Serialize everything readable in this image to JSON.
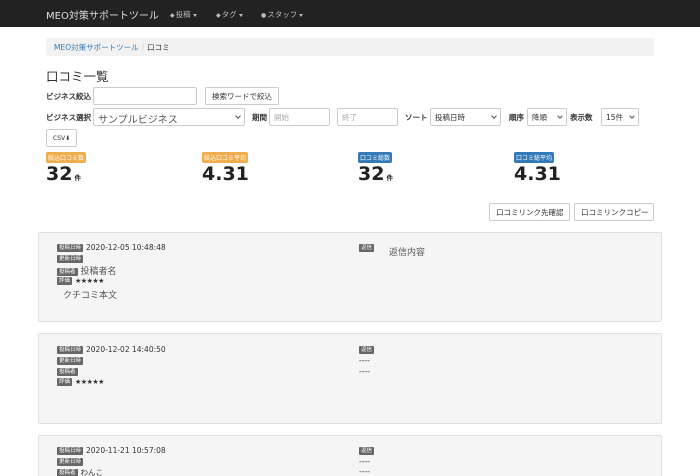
{
  "navbar": {
    "brand": "MEO対策サポートツール",
    "items": [
      {
        "icon": "tag-icon",
        "label": "投稿"
      },
      {
        "icon": "tags-icon",
        "label": "タグ"
      },
      {
        "icon": "user-icon",
        "label": "スタッフ"
      }
    ]
  },
  "breadcrumb": {
    "items": [
      "MEO対策サポートツール",
      "口コミ"
    ]
  },
  "page_title": "口コミ一覧",
  "filters": {
    "business_filter_label": "ビジネス絞込",
    "business_filter_value": "",
    "search_button": "検索ワードで絞込",
    "business_select_label": "ビジネス選択",
    "business_select_value": "サンプルビジネス",
    "period_label": "期間",
    "start_placeholder": "開始",
    "end_placeholder": "終了",
    "sort_label": "ソート",
    "sort_value": "投稿日時",
    "order_label": "順序",
    "order_value": "降順",
    "count_label": "表示数",
    "count_value": "15件",
    "csv_button": "CSV"
  },
  "stats": [
    {
      "label": "絞込口コミ数",
      "value": "32",
      "unit": "件",
      "color": "#f0ad4e"
    },
    {
      "label": "絞込口コミ平均",
      "value": "4.31",
      "unit": "",
      "color": "#f0ad4e"
    },
    {
      "label": "口コミ総数",
      "value": "32",
      "unit": "件",
      "color": "#337ab7"
    },
    {
      "label": "口コミ総平均",
      "value": "4.31",
      "unit": "",
      "color": "#337ab7"
    }
  ],
  "actions": {
    "confirm_link": "口コミリンク先確認",
    "copy_link": "口コミリンクコピー"
  },
  "labels": {
    "posted_at": "投稿日時",
    "updated_at": "更新日時",
    "poster": "投稿者",
    "rating": "評価",
    "reply": "返信"
  },
  "reviews": [
    {
      "posted_at": "2020-12-05 10:48:48",
      "updated_at": "",
      "poster": "投稿者名",
      "stars": "★★★★★",
      "body": "クチコミ本文",
      "reply": "返信内容"
    },
    {
      "posted_at": "2020-12-02 14:40:50",
      "updated_at": "",
      "poster": "",
      "stars": "★★★★★",
      "body": "",
      "reply_lines": [
        "----",
        "----"
      ]
    },
    {
      "posted_at": "2020-11-21 10:57:08",
      "updated_at": "",
      "poster": "わんこ",
      "stars": "",
      "body": "",
      "reply_lines": [
        "----",
        "----"
      ]
    }
  ]
}
